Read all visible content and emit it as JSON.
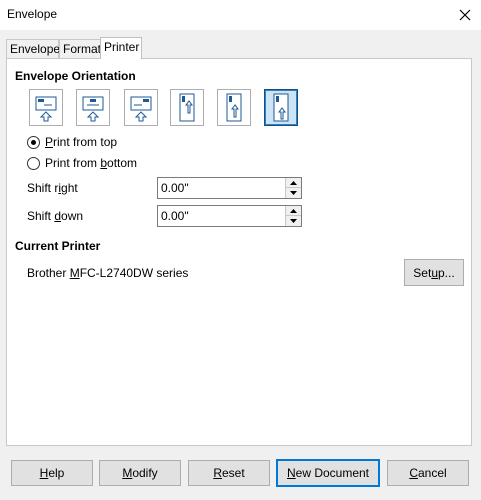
{
  "window": {
    "title": "Envelope"
  },
  "tabs": [
    {
      "label": "Envelope",
      "active": false
    },
    {
      "label": "Format",
      "active": false
    },
    {
      "label": "Printer",
      "active": true
    }
  ],
  "orientation": {
    "title": "Envelope Orientation",
    "options": [
      {
        "icon": "envelope-horizontal-left-icon",
        "selected": false
      },
      {
        "icon": "envelope-horizontal-center-icon",
        "selected": false
      },
      {
        "icon": "envelope-horizontal-right-icon",
        "selected": false
      },
      {
        "icon": "envelope-vertical-left-icon",
        "selected": false
      },
      {
        "icon": "envelope-vertical-center-icon",
        "selected": false
      },
      {
        "icon": "envelope-vertical-right-icon",
        "selected": true
      }
    ],
    "print_from_top": {
      "label_mnemonic": "P",
      "label_rest": "rint from top",
      "checked": true
    },
    "print_from_bottom": {
      "label_prefix": "Print from ",
      "label_mnemonic": "b",
      "label_rest": "ottom",
      "checked": false
    },
    "shift_right": {
      "label_prefix": "Shift r",
      "label_mnemonic": "i",
      "label_rest": "ght",
      "value": "0.00\""
    },
    "shift_down": {
      "label_prefix": "Shift ",
      "label_mnemonic": "d",
      "label_rest": "own",
      "value": "0.00\""
    }
  },
  "printer": {
    "title": "Current Printer",
    "name_prefix": "Brother ",
    "name_mnemonic": "M",
    "name_rest": "FC-L2740DW series",
    "setup_prefix": "Set",
    "setup_mnemonic": "u",
    "setup_rest": "p..."
  },
  "buttons": {
    "help": {
      "mnemonic": "H",
      "rest": "elp"
    },
    "modify": {
      "mnemonic": "M",
      "rest": "odify"
    },
    "reset": {
      "mnemonic": "R",
      "rest": "eset"
    },
    "new_document": {
      "mnemonic": "N",
      "rest": "ew Document"
    },
    "cancel": {
      "mnemonic": "C",
      "rest": "ancel"
    }
  },
  "colors": {
    "accent": "#0078d7",
    "selected_fill": "#cce4f7",
    "icon_blue": "#1e5a96"
  }
}
